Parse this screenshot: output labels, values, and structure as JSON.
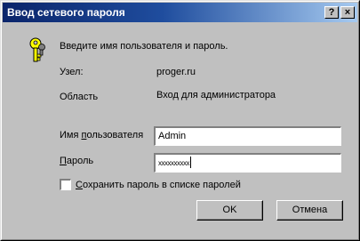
{
  "window": {
    "title": "Ввод сетевого пароля",
    "help_button": "?",
    "close_button": "×"
  },
  "prompt": "Введите имя пользователя и пароль.",
  "host": {
    "label": "Узел:",
    "value": "proger.ru"
  },
  "realm": {
    "label": "Область",
    "value": "Вход для администратора"
  },
  "username": {
    "label_before": "Имя ",
    "label_access": "п",
    "label_after": "ользователя",
    "value": "Admin"
  },
  "password": {
    "label_access": "П",
    "label_after": "ароль",
    "value": "xxxxxxxxxx"
  },
  "remember": {
    "label_access": "С",
    "label_after": "охранить пароль в списке паролей",
    "checked": false
  },
  "buttons": {
    "ok": "OK",
    "cancel": "Отмена"
  },
  "icons": {
    "key": "keys-icon"
  },
  "colors": {
    "titlebar_start": "#0a246a",
    "titlebar_end": "#a6caf0",
    "face": "#c0c0c0"
  }
}
